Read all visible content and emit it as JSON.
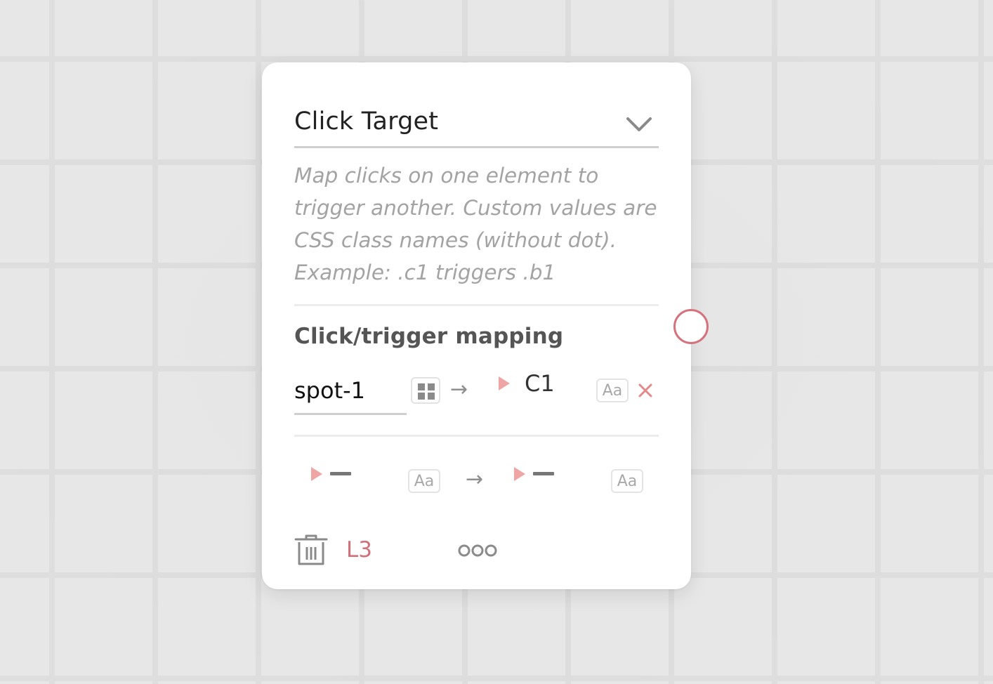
{
  "panel": {
    "type_select": {
      "value": "Click Target",
      "icon": "chevron-down-icon"
    },
    "description": "Map clicks on one element to trigger another. Custom values are CSS class names (without dot). Example: .c1 triggers .b1",
    "mapping_section": {
      "title": "Click/trigger mapping",
      "rows": [
        {
          "source": "spot-1",
          "target": "C1",
          "text_toggle": "Aa"
        },
        {
          "source": "",
          "target": "",
          "source_text_toggle": "Aa",
          "target_text_toggle": "Aa"
        }
      ]
    },
    "footer": {
      "level": "L3",
      "delete_icon": "trash-icon",
      "more_icon": "more-icon"
    }
  },
  "colors": {
    "accent": "#d4737e",
    "play": "#f0a5a5",
    "canvas": "#e6e6e6"
  }
}
